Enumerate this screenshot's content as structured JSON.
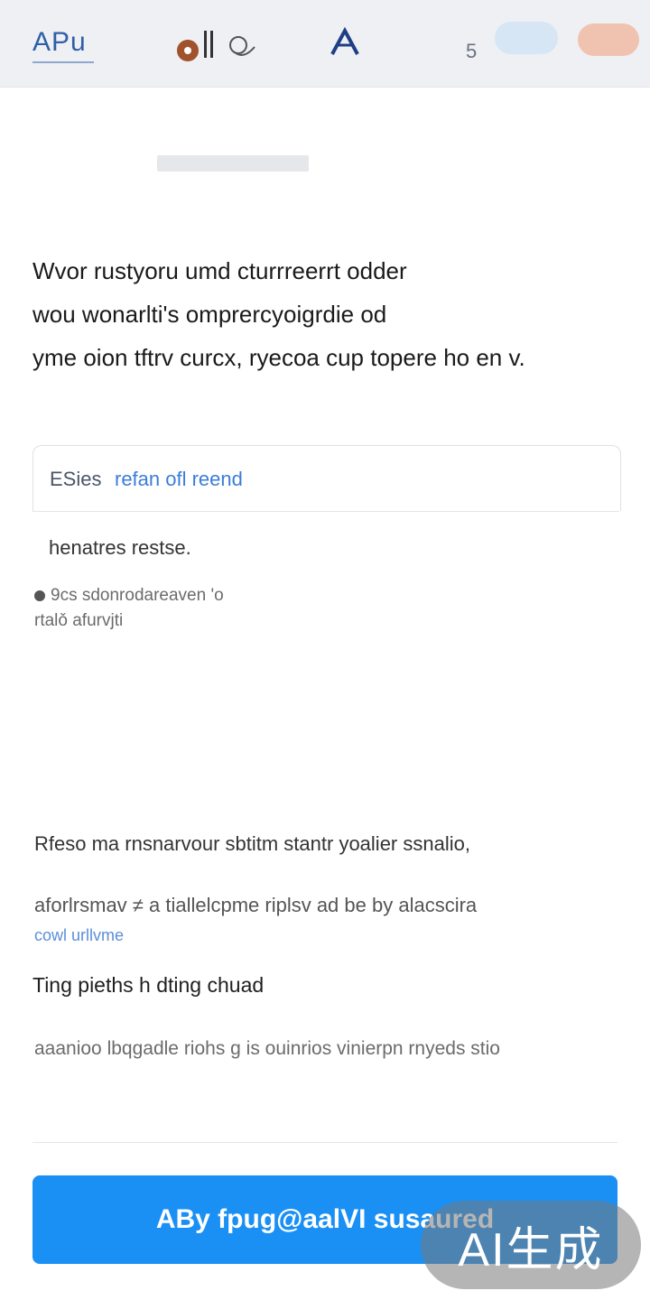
{
  "header": {
    "brand": "APu",
    "badge": "5"
  },
  "intro": {
    "lines": [
      "Wvor rustyoru umd cturrreerrt odder",
      "wou wonarlti's omprercyoigrdie od",
      "yme oion tftrv curcx, ryecoa cup topere ho en v."
    ]
  },
  "card": {
    "label": "ESies",
    "link": "refan ofl reend"
  },
  "subhead": "henatres restse.",
  "note": {
    "line1": "9cs sdonrodareaven 'o",
    "line2": "rtalǒ afurvjti"
  },
  "body": {
    "para1": "Rfeso ma rnsnarvour sbtitm stantr yoalier ssnalio,",
    "para2": "aforlrsmav ≠ a tiallelcpme riplsv ad be by alacscira",
    "para2_link": "cowl urllvme",
    "section_heading": "Ting pieths h dting chuad",
    "para3": "aaanioo lbqgadle riohs g is ouinrios vinierpn rnyeds stio"
  },
  "cta": {
    "label": "ABy fpug@aalVI susaured"
  },
  "watermark": "AI生成",
  "colors": {
    "accent": "#1a90f5",
    "link": "#3b7dd8",
    "header_bg": "#eef0f4"
  }
}
